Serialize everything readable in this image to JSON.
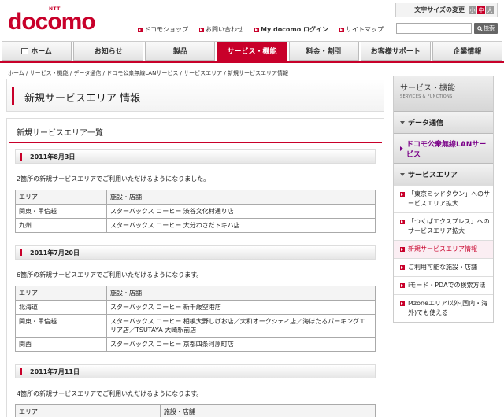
{
  "logo": {
    "ntt": "NTT",
    "word": "docomo"
  },
  "font_size": {
    "label": "文字サイズの変更",
    "options": [
      "小",
      "中",
      "大"
    ],
    "selected": 1
  },
  "utility_links": [
    "ドコモショップ",
    "お問い合わせ",
    "My docomo ログイン",
    "サイトマップ"
  ],
  "search": {
    "button": "検索",
    "placeholder": ""
  },
  "nav": [
    {
      "label": "ホーム",
      "active": false
    },
    {
      "label": "お知らせ",
      "active": false
    },
    {
      "label": "製品",
      "active": false
    },
    {
      "label": "サービス・機能",
      "active": true
    },
    {
      "label": "料金・割引",
      "active": false
    },
    {
      "label": "お客様サポート",
      "active": false
    },
    {
      "label": "企業情報",
      "active": false
    }
  ],
  "breadcrumb": [
    "ホーム",
    "サービス・機能",
    "データ通信",
    "ドコモ公衆無線LANサービス",
    "サービスエリア",
    "新規サービスエリア情報"
  ],
  "page_title": "新規サービスエリア 情報",
  "list_title": "新規サービスエリア一覧",
  "entries": [
    {
      "date": "2011年8月3日",
      "lead": "2箇所の新規サービスエリアでご利用いただけるようになりました。",
      "headers": [
        "エリア",
        "施設・店舗"
      ],
      "rows": [
        [
          "関東・甲信越",
          "スターバックス コーヒー 渋谷文化村通り店"
        ],
        [
          "九州",
          "スターバックス コーヒー 大分わさだトキハ店"
        ]
      ]
    },
    {
      "date": "2011年7月20日",
      "lead": "6箇所の新規サービスエリアでご利用いただけるようになります。",
      "headers": [
        "エリア",
        "施設・店舗"
      ],
      "rows": [
        [
          "北海道",
          "スターバックス コーヒー 新千歳空港店"
        ],
        [
          "関東・甲信越",
          "スターバックス コーヒー 相模大野しげお店／大和オークシティ店／海ほたるパーキングエリア店／TSUTAYA 大崎駅前店"
        ],
        [
          "関西",
          "スターバックス コーヒー 京都四条河原町店"
        ]
      ]
    },
    {
      "date": "2011年7月11日",
      "lead": "4箇所の新規サービスエリアでご利用いただけるようになります。",
      "headers": [
        "エリア",
        "施設・店舗"
      ],
      "rows": []
    }
  ],
  "sidebar": {
    "title": "サービス・機能",
    "subtitle": "SERVICES & FUNCTIONS",
    "sections": [
      {
        "label": "データ通信",
        "kind": "down"
      },
      {
        "label": "ドコモ公衆無線LANサービス",
        "kind": "right"
      },
      {
        "label": "サービスエリア",
        "kind": "down"
      }
    ],
    "items": [
      {
        "label": "「東京ミッドタウン」へのサービスエリア拡大",
        "current": false
      },
      {
        "label": "「つくばエクスプレス」へのサービスエリア拡大",
        "current": false
      },
      {
        "label": "新規サービスエリア情報",
        "current": true
      },
      {
        "label": "ご利用可能な施設・店舗",
        "current": false
      },
      {
        "label": "iモード・PDAでの検索方法",
        "current": false
      },
      {
        "label": "Mzoneエリア以外(国内・海外)でも使える",
        "current": false
      }
    ]
  },
  "colors": {
    "brand": "#c8002a",
    "sidebar_active": "#7a0088"
  }
}
